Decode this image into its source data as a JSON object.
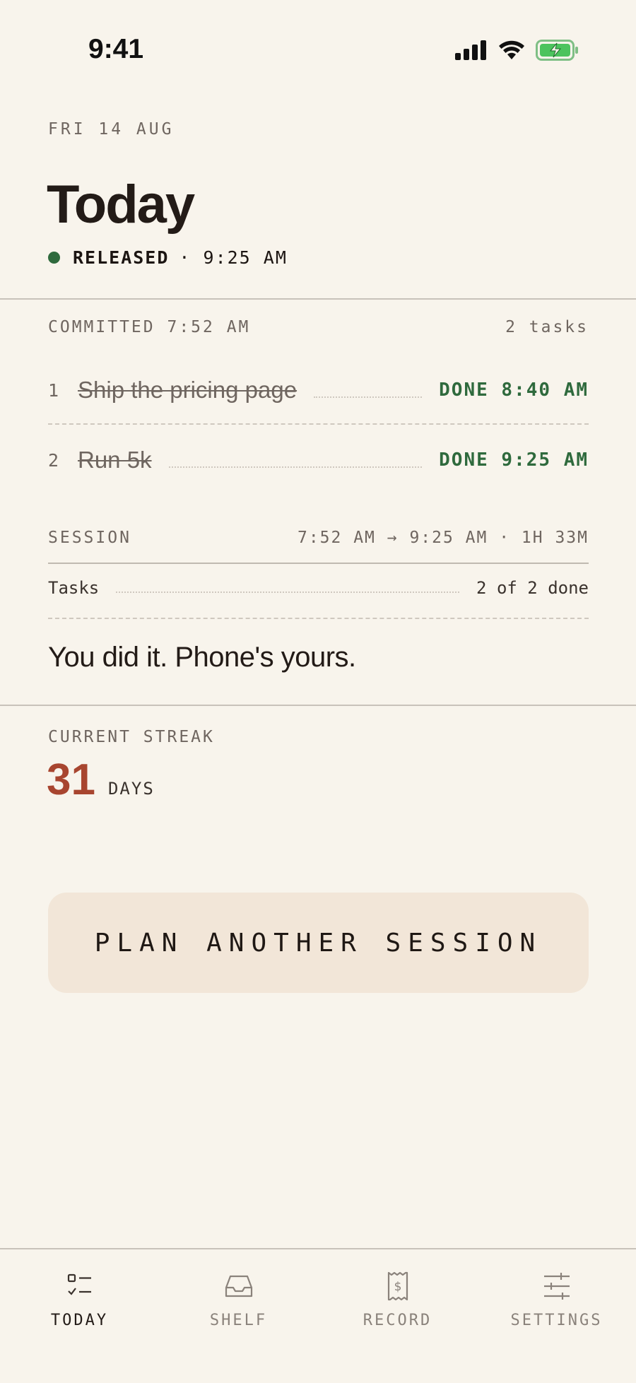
{
  "status_bar": {
    "time": "9:41"
  },
  "header": {
    "date": "FRI 14 AUG",
    "title": "Today",
    "status_label": "RELEASED",
    "status_time": "· 9:25 AM",
    "status_color": "#2f6a3d"
  },
  "committed": {
    "label": "COMMITTED 7:52 AM",
    "count": "2 tasks",
    "tasks": [
      {
        "num": "1",
        "text": "Ship the pricing page",
        "status": "DONE 8:40 AM"
      },
      {
        "num": "2",
        "text": "Run 5k",
        "status": "DONE 9:25 AM"
      }
    ]
  },
  "session": {
    "label": "SESSION",
    "range": "7:52 AM → 9:25 AM · 1H 33M",
    "tasks_label": "Tasks",
    "tasks_value": "2 of 2 done",
    "message": "You did it. Phone's yours."
  },
  "streak": {
    "label": "CURRENT STREAK",
    "value": "31",
    "unit": "DAYS",
    "color": "#a8452f"
  },
  "cta": {
    "label": "PLAN ANOTHER SESSION"
  },
  "tabbar": {
    "items": [
      {
        "label": "TODAY",
        "icon": "checklist-icon",
        "active": true
      },
      {
        "label": "SHELF",
        "icon": "inbox-tray-icon",
        "active": false
      },
      {
        "label": "RECORD",
        "icon": "receipt-dollar-icon",
        "active": false
      },
      {
        "label": "SETTINGS",
        "icon": "sliders-icon",
        "active": false
      }
    ]
  }
}
